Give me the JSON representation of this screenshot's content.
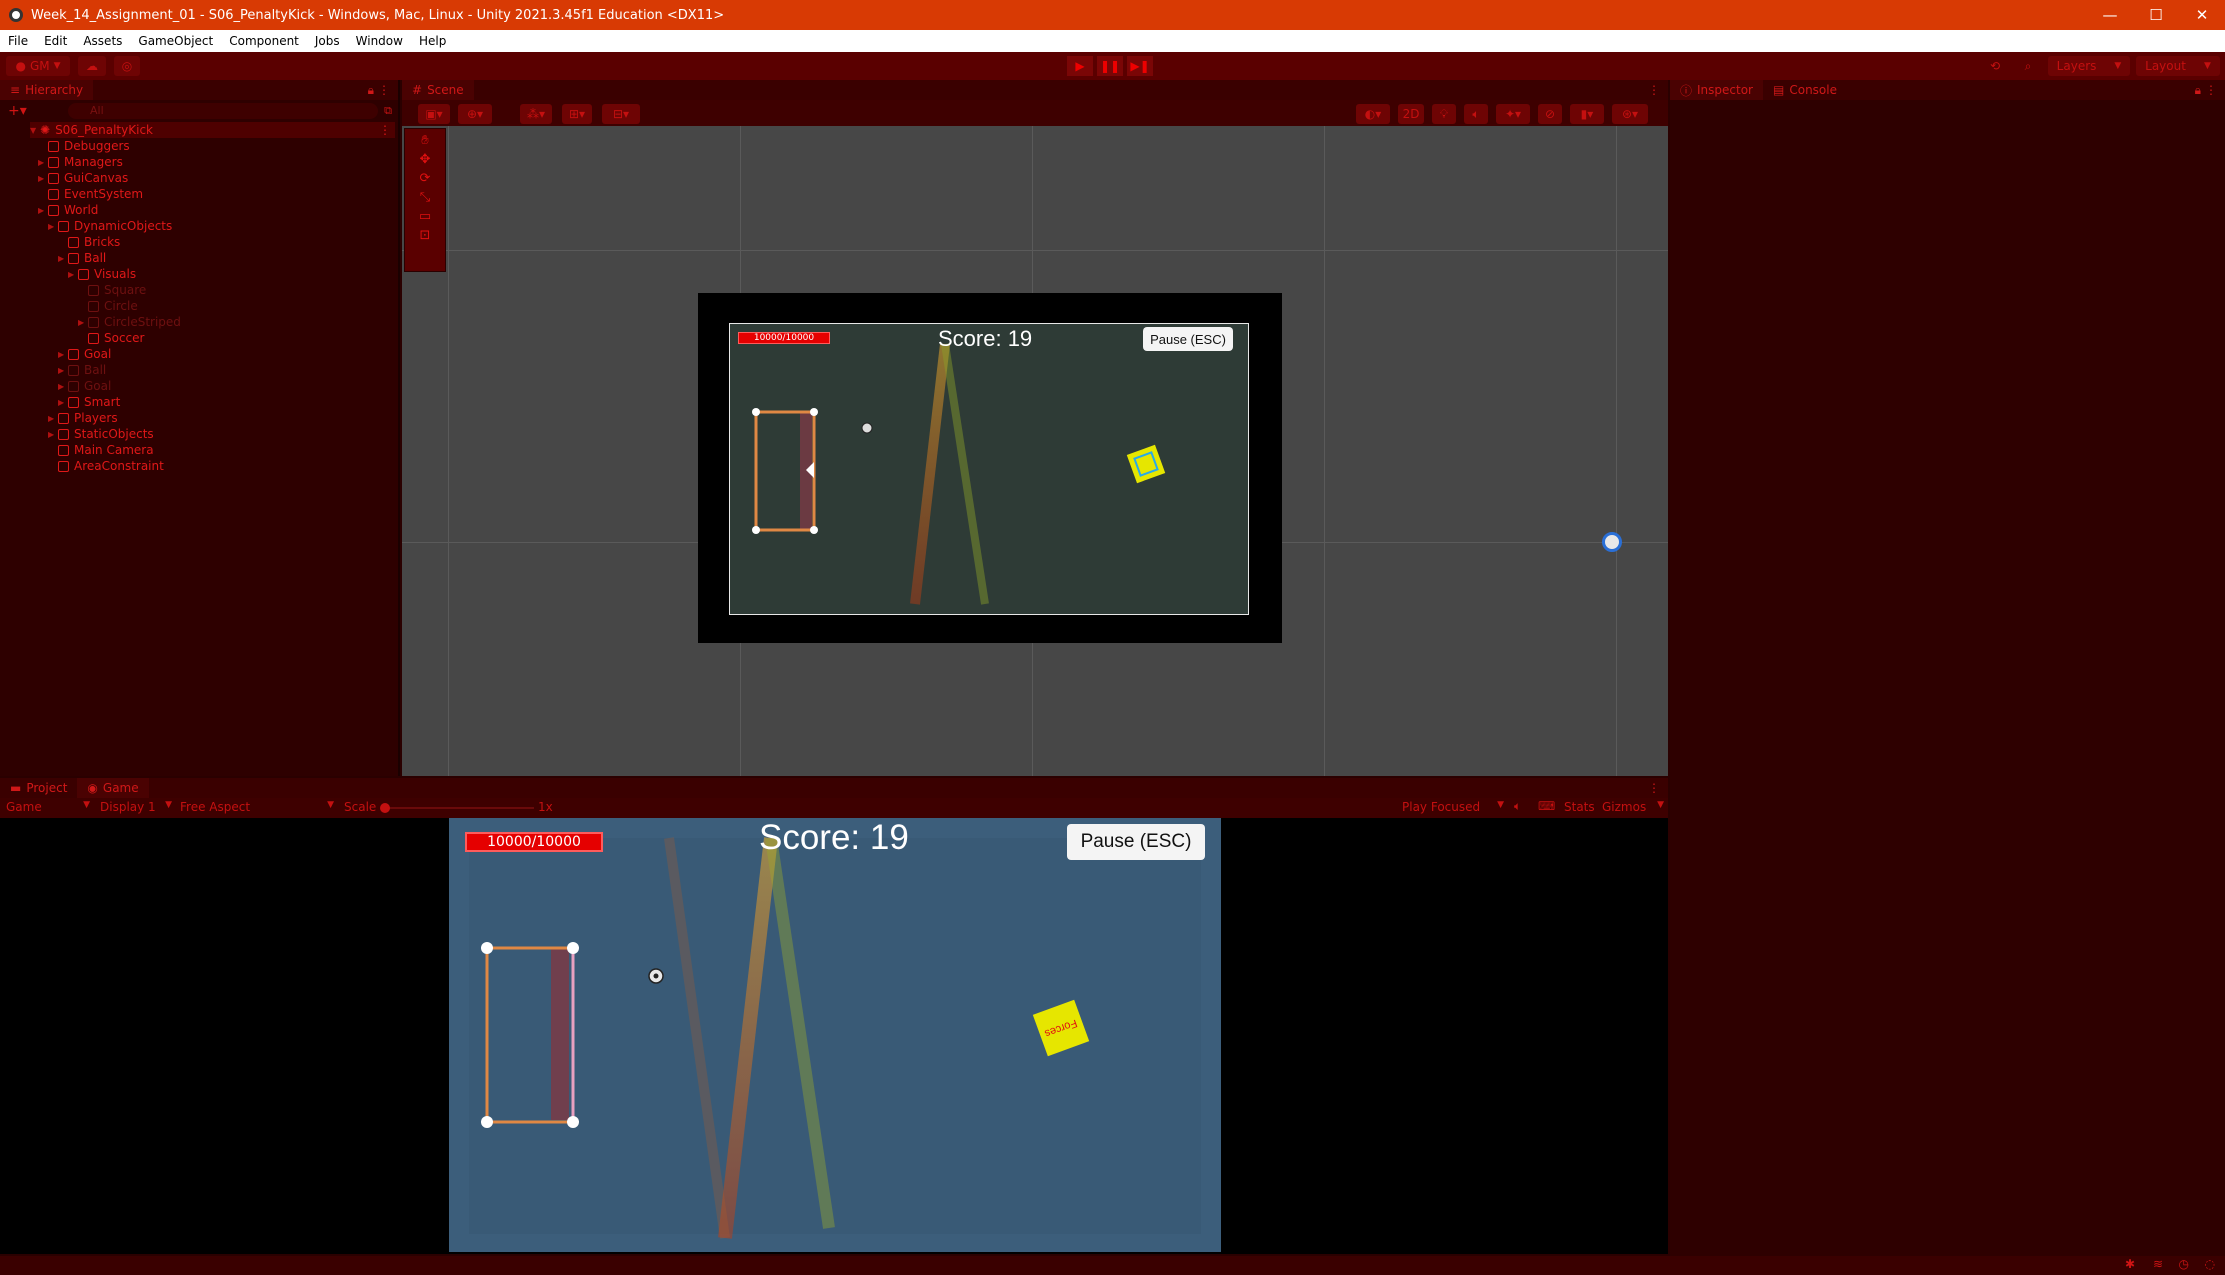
{
  "window": {
    "title": "Week_14_Assignment_01 - S06_PenaltyKick - Windows, Mac, Linux - Unity 2021.3.45f1 Education <DX11>",
    "controls": [
      "—",
      "☐",
      "✕"
    ]
  },
  "menu": [
    "File",
    "Edit",
    "Assets",
    "GameObject",
    "Component",
    "Jobs",
    "Window",
    "Help"
  ],
  "toolbar": {
    "account": "GM",
    "layers": "Layers",
    "layout": "Layout"
  },
  "hierarchy": {
    "tab": "Hierarchy",
    "search_placeholder": "All",
    "scene": "S06_PenaltyKick",
    "items": [
      {
        "label": "Debuggers",
        "depth": 1,
        "arrow": false,
        "dim": false
      },
      {
        "label": "Managers",
        "depth": 1,
        "arrow": true,
        "dim": false
      },
      {
        "label": "GuiCanvas",
        "depth": 1,
        "arrow": true,
        "dim": false
      },
      {
        "label": "EventSystem",
        "depth": 1,
        "arrow": false,
        "dim": false
      },
      {
        "label": "World",
        "depth": 1,
        "arrow": true,
        "dim": false
      },
      {
        "label": "DynamicObjects",
        "depth": 2,
        "arrow": true,
        "dim": false
      },
      {
        "label": "Bricks",
        "depth": 3,
        "arrow": false,
        "dim": false
      },
      {
        "label": "Ball",
        "depth": 3,
        "arrow": true,
        "dim": false
      },
      {
        "label": "Visuals",
        "depth": 4,
        "arrow": true,
        "dim": false
      },
      {
        "label": "Square",
        "depth": 5,
        "arrow": false,
        "dim": true
      },
      {
        "label": "Circle",
        "depth": 5,
        "arrow": false,
        "dim": true
      },
      {
        "label": "CircleStriped",
        "depth": 5,
        "arrow": true,
        "dim": true
      },
      {
        "label": "Soccer",
        "depth": 5,
        "arrow": false,
        "dim": false
      },
      {
        "label": "Goal",
        "depth": 3,
        "arrow": true,
        "dim": false
      },
      {
        "label": "Ball",
        "depth": 3,
        "arrow": true,
        "dim": true
      },
      {
        "label": "Goal",
        "depth": 3,
        "arrow": true,
        "dim": true
      },
      {
        "label": "Smart",
        "depth": 3,
        "arrow": true,
        "dim": false
      },
      {
        "label": "Players",
        "depth": 2,
        "arrow": true,
        "dim": false
      },
      {
        "label": "StaticObjects",
        "depth": 2,
        "arrow": true,
        "dim": false
      },
      {
        "label": "Main Camera",
        "depth": 2,
        "arrow": false,
        "dim": false
      },
      {
        "label": "AreaConstraint",
        "depth": 2,
        "arrow": false,
        "dim": false
      }
    ]
  },
  "scene": {
    "tab": "Scene",
    "mode_2d": "2D",
    "overlay": {
      "health": "10000/10000",
      "score": "Score: 19",
      "pause": "Pause (ESC)"
    }
  },
  "inspector": {
    "tabs": [
      "Inspector",
      "Console"
    ]
  },
  "game": {
    "tabs": [
      "Project",
      "Game"
    ],
    "view_mode": "Game",
    "display": "Display 1",
    "aspect": "Free Aspect",
    "scale_label": "Scale",
    "scale_value": "1x",
    "play_mode": "Play Focused",
    "stats": "Stats",
    "gizmos": "Gizmos",
    "overlay": {
      "health": "10000/10000",
      "score": "Score: 19",
      "pause": "Pause (ESC)",
      "brick_label": "Forces"
    }
  }
}
